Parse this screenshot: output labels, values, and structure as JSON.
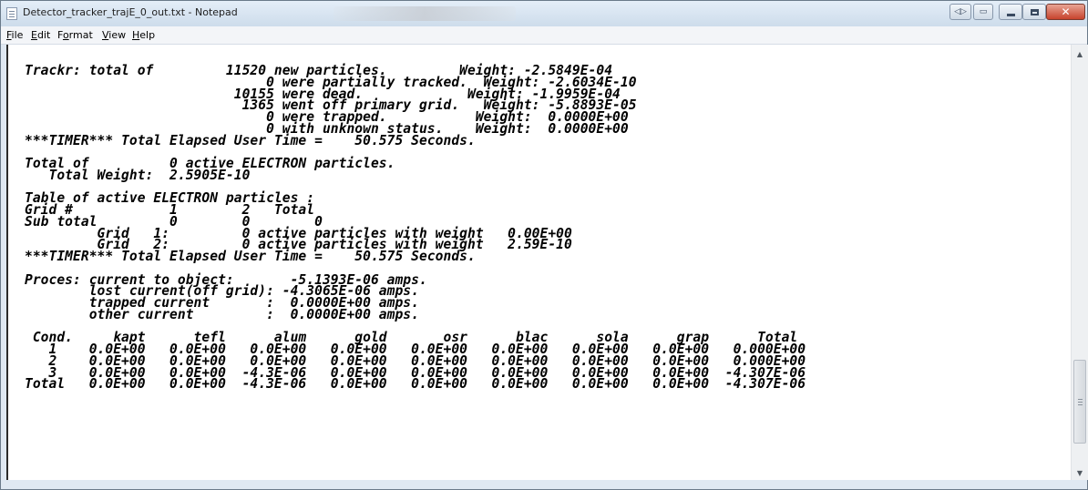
{
  "window": {
    "title": "Detector_tracker_trajE_0_out.txt - Notepad",
    "icon": "notepad-icon",
    "controls": {
      "aero": "◁▷",
      "restore": "▭"
    }
  },
  "menu": {
    "file": {
      "u": "F",
      "rest": "ile"
    },
    "edit": {
      "u": "E",
      "rest": "dit"
    },
    "format": {
      "pre": "F",
      "u": "o",
      "rest": "rmat"
    },
    "view": {
      "u": "V",
      "rest": "iew"
    },
    "help": {
      "u": "H",
      "rest": "elp"
    }
  },
  "document": {
    "lines": [
      "Trackr: total of         11520 new particles.         Weight: -2.5849E-04",
      "                              0 were partially tracked.  Weight: -2.6034E-10",
      "                          10155 were dead.             Weight: -1.9959E-04",
      "                           1365 went off primary grid.   Weight: -5.8893E-05",
      "                              0 were trapped.           Weight:  0.0000E+00",
      "                              0 with unknown status.    Weight:  0.0000E+00",
      "***TIMER*** Total Elapsed User Time =    50.575 Seconds.",
      "",
      "Total of          0 active ELECTRON particles.",
      "   Total Weight:  2.5905E-10",
      "",
      "Table of active ELECTRON particles :",
      "Grid #            1        2   Total",
      "Sub total         0        0        0",
      "         Grid   1:         0 active particles with weight   0.00E+00",
      "         Grid   2:         0 active particles with weight   2.59E-10",
      "***TIMER*** Total Elapsed User Time =    50.575 Seconds.",
      "",
      "Proces: current to object:       -5.1393E-06 amps.",
      "        lost current(off grid): -4.3065E-06 amps.",
      "        trapped current       :  0.0000E+00 amps.",
      "        other current         :  0.0000E+00 amps.",
      "",
      " Cond.     kapt      tefl      alum      gold       osr      blac      sola      grap      Total",
      "   1    0.0E+00   0.0E+00   0.0E+00   0.0E+00   0.0E+00   0.0E+00   0.0E+00   0.0E+00   0.000E+00",
      "   2    0.0E+00   0.0E+00   0.0E+00   0.0E+00   0.0E+00   0.0E+00   0.0E+00   0.0E+00   0.000E+00",
      "   3    0.0E+00   0.0E+00  -4.3E-06   0.0E+00   0.0E+00   0.0E+00   0.0E+00   0.0E+00  -4.307E-06",
      "Total   0.0E+00   0.0E+00  -4.3E-06   0.0E+00   0.0E+00   0.0E+00   0.0E+00   0.0E+00  -4.307E-06"
    ]
  },
  "scrollbar": {
    "up": "▲",
    "down": "▼"
  }
}
